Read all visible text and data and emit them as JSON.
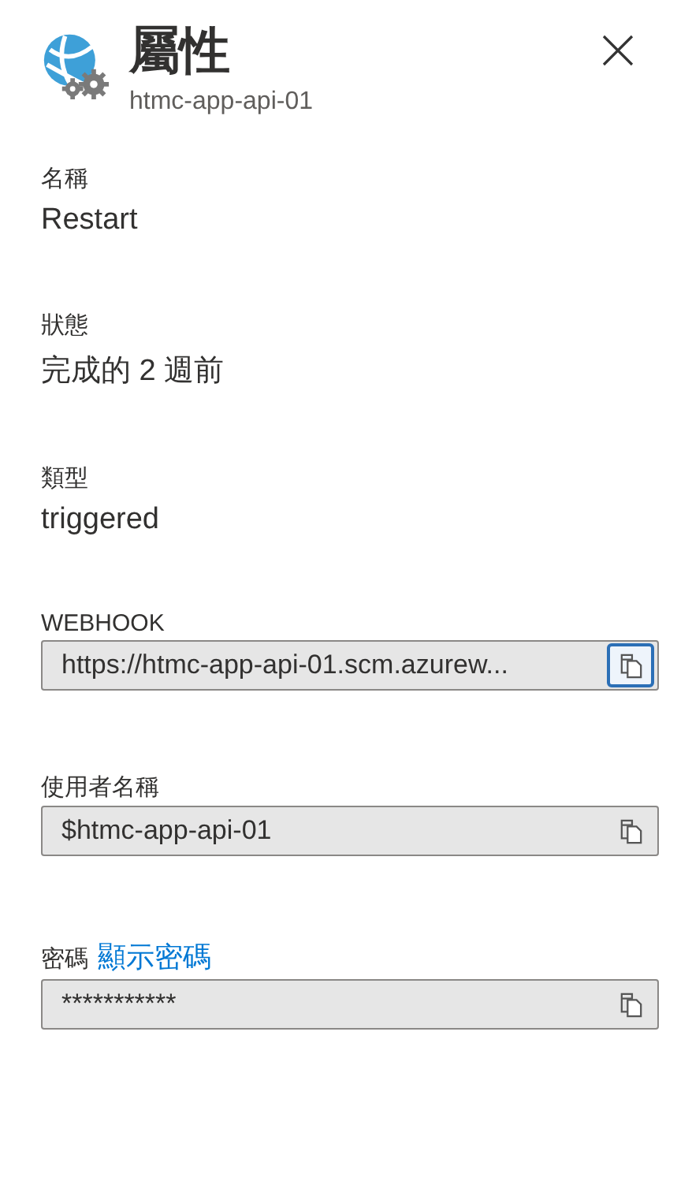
{
  "header": {
    "title": "屬性",
    "subtitle": "htmc-app-api-01"
  },
  "properties": [
    {
      "kind": "text",
      "label": "名稱",
      "value": "Restart"
    },
    {
      "kind": "text",
      "label": "狀態",
      "value": "完成的 2 週前"
    },
    {
      "kind": "text",
      "label": "類型",
      "value": "triggered"
    },
    {
      "kind": "copy-field",
      "label": "WEBHOOK",
      "value": "https://htmc-app-api-01.scm.azurew...",
      "copy_focused": true
    },
    {
      "kind": "copy-field",
      "label": "使用者名稱",
      "value": "$htmc-app-api-01",
      "copy_focused": false
    },
    {
      "kind": "copy-field",
      "label": "密碼",
      "link": "顯示密碼",
      "value": "***********",
      "copy_focused": false
    }
  ]
}
